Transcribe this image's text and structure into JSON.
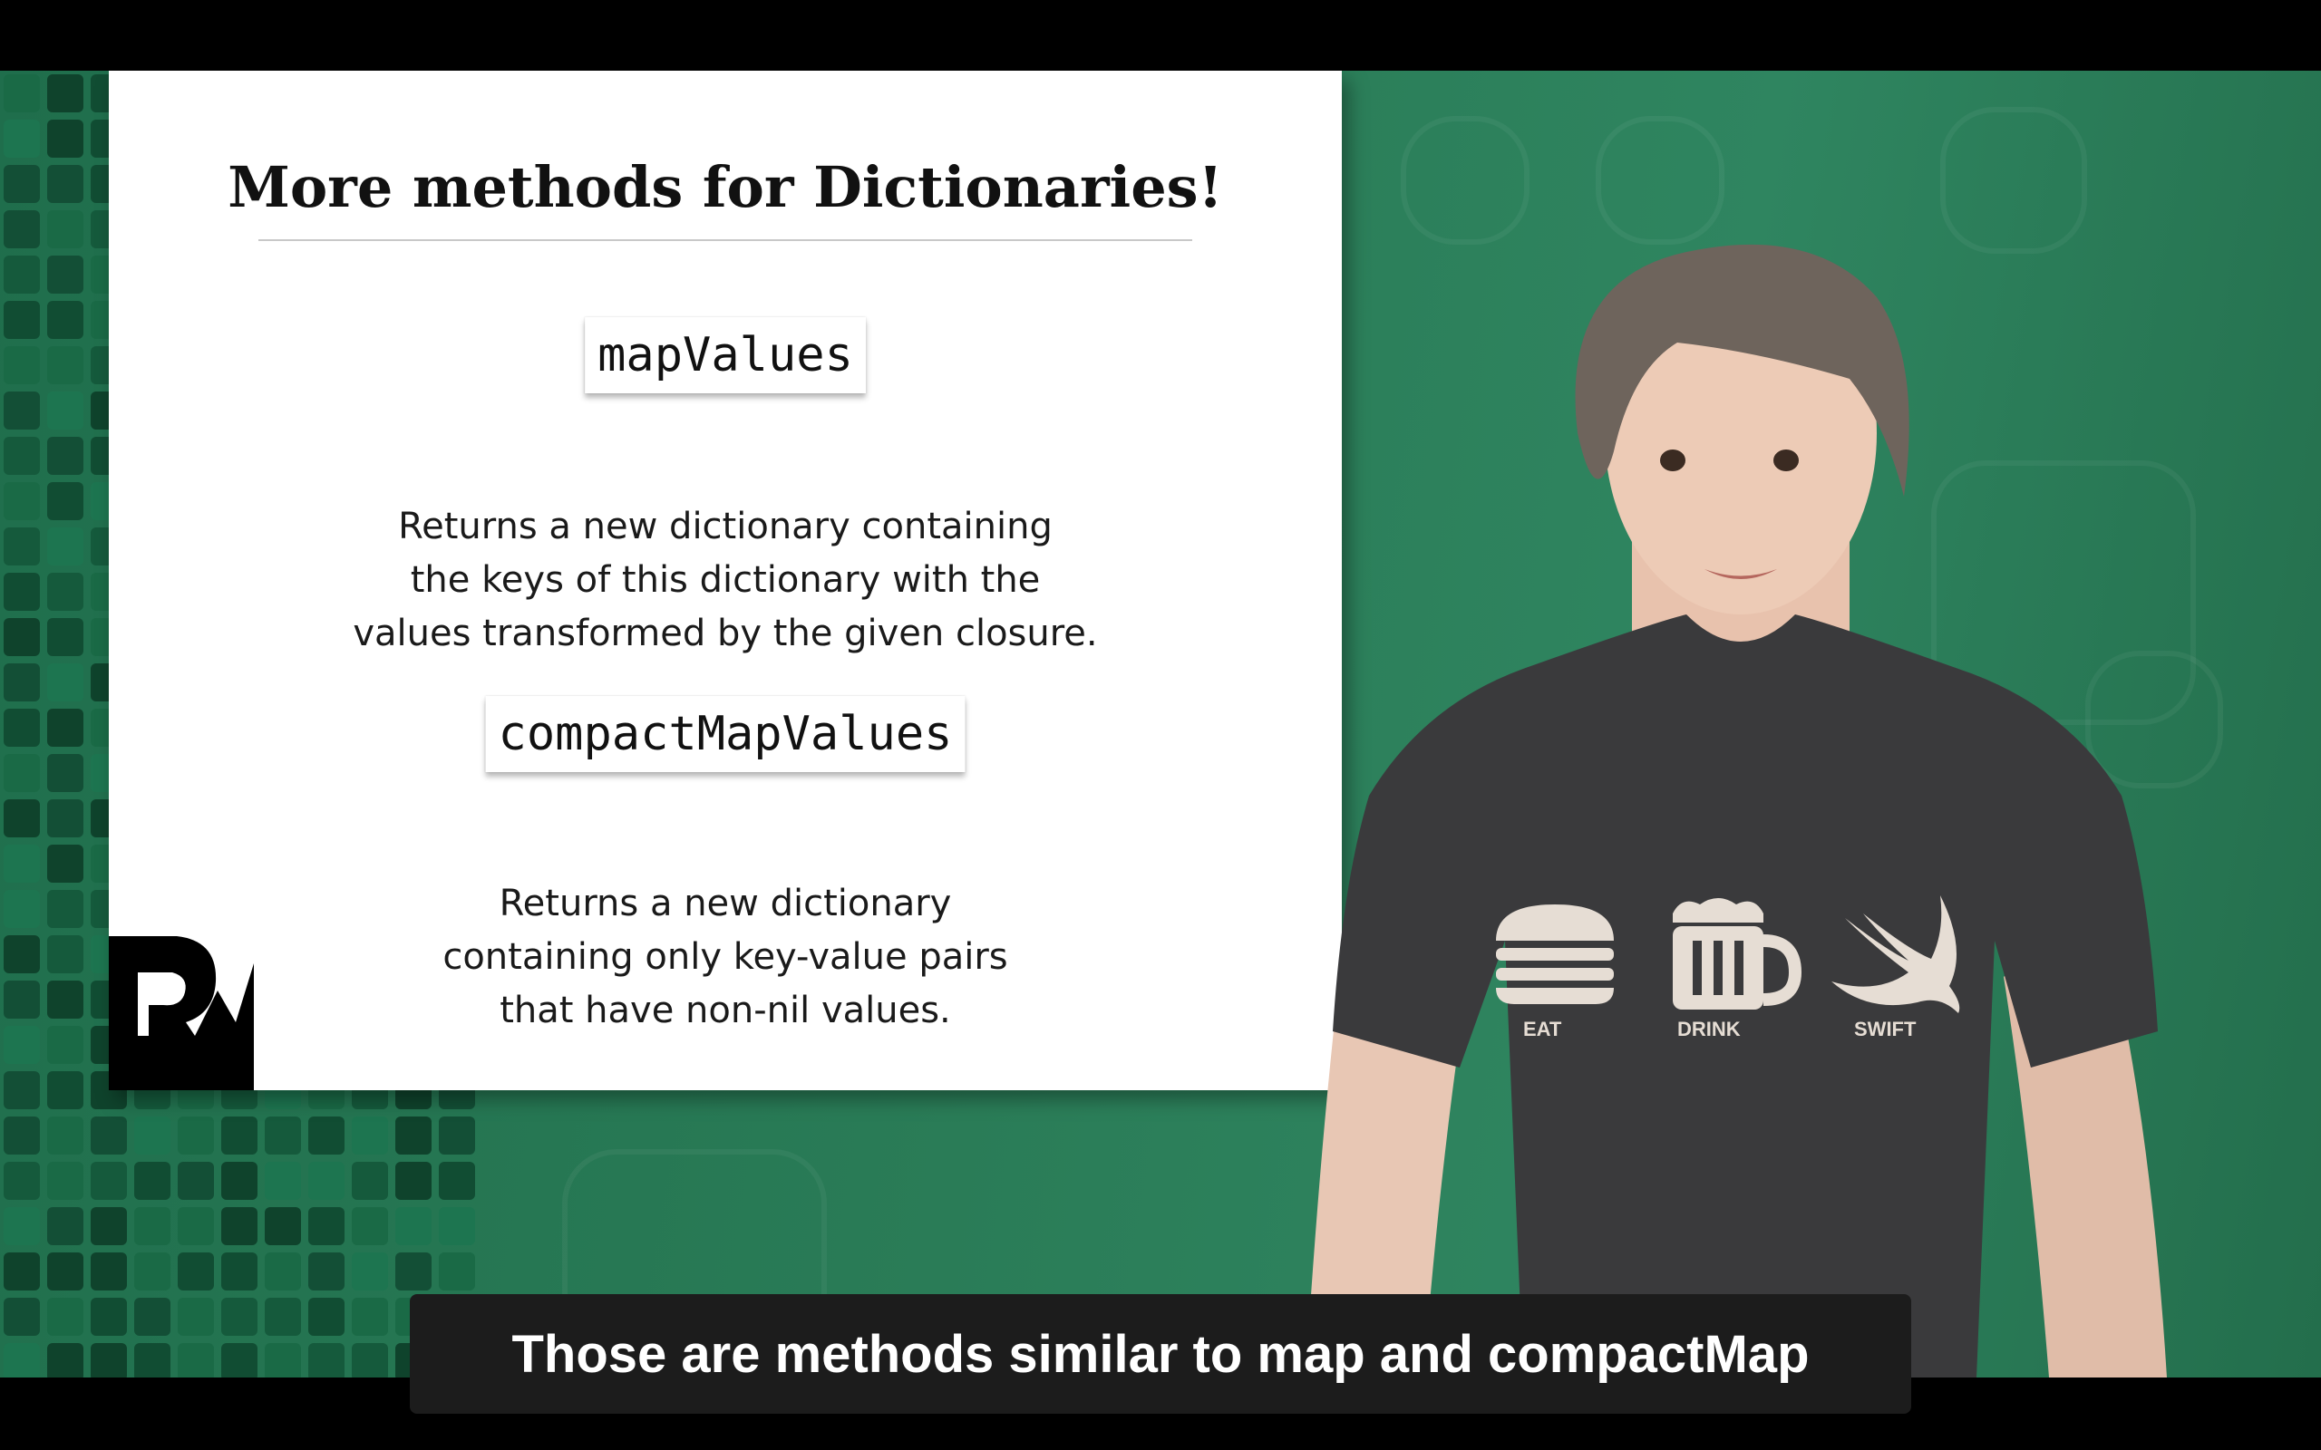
{
  "slide": {
    "title": "More methods for Dictionaries!",
    "methods": [
      {
        "name": "mapValues",
        "description_lines": [
          "Returns a new dictionary containing",
          "the keys of this dictionary with the",
          "values transformed by the given closure."
        ]
      },
      {
        "name": "compactMapValues",
        "description_lines": [
          "Returns a new dictionary",
          "containing only key-value pairs",
          "that have non-nil values."
        ]
      }
    ]
  },
  "shirt": {
    "labels": [
      "EAT",
      "DRINK",
      "SWIFT"
    ],
    "icons": [
      "burger-icon",
      "beer-mug-icon",
      "swift-bird-icon"
    ]
  },
  "caption": {
    "text": "Those are methods similar to map and compactMap"
  },
  "colors": {
    "background_green": "#2a7c57",
    "shirt_gray": "#3a3a3c",
    "caption_bg": "#1c1c1c"
  }
}
